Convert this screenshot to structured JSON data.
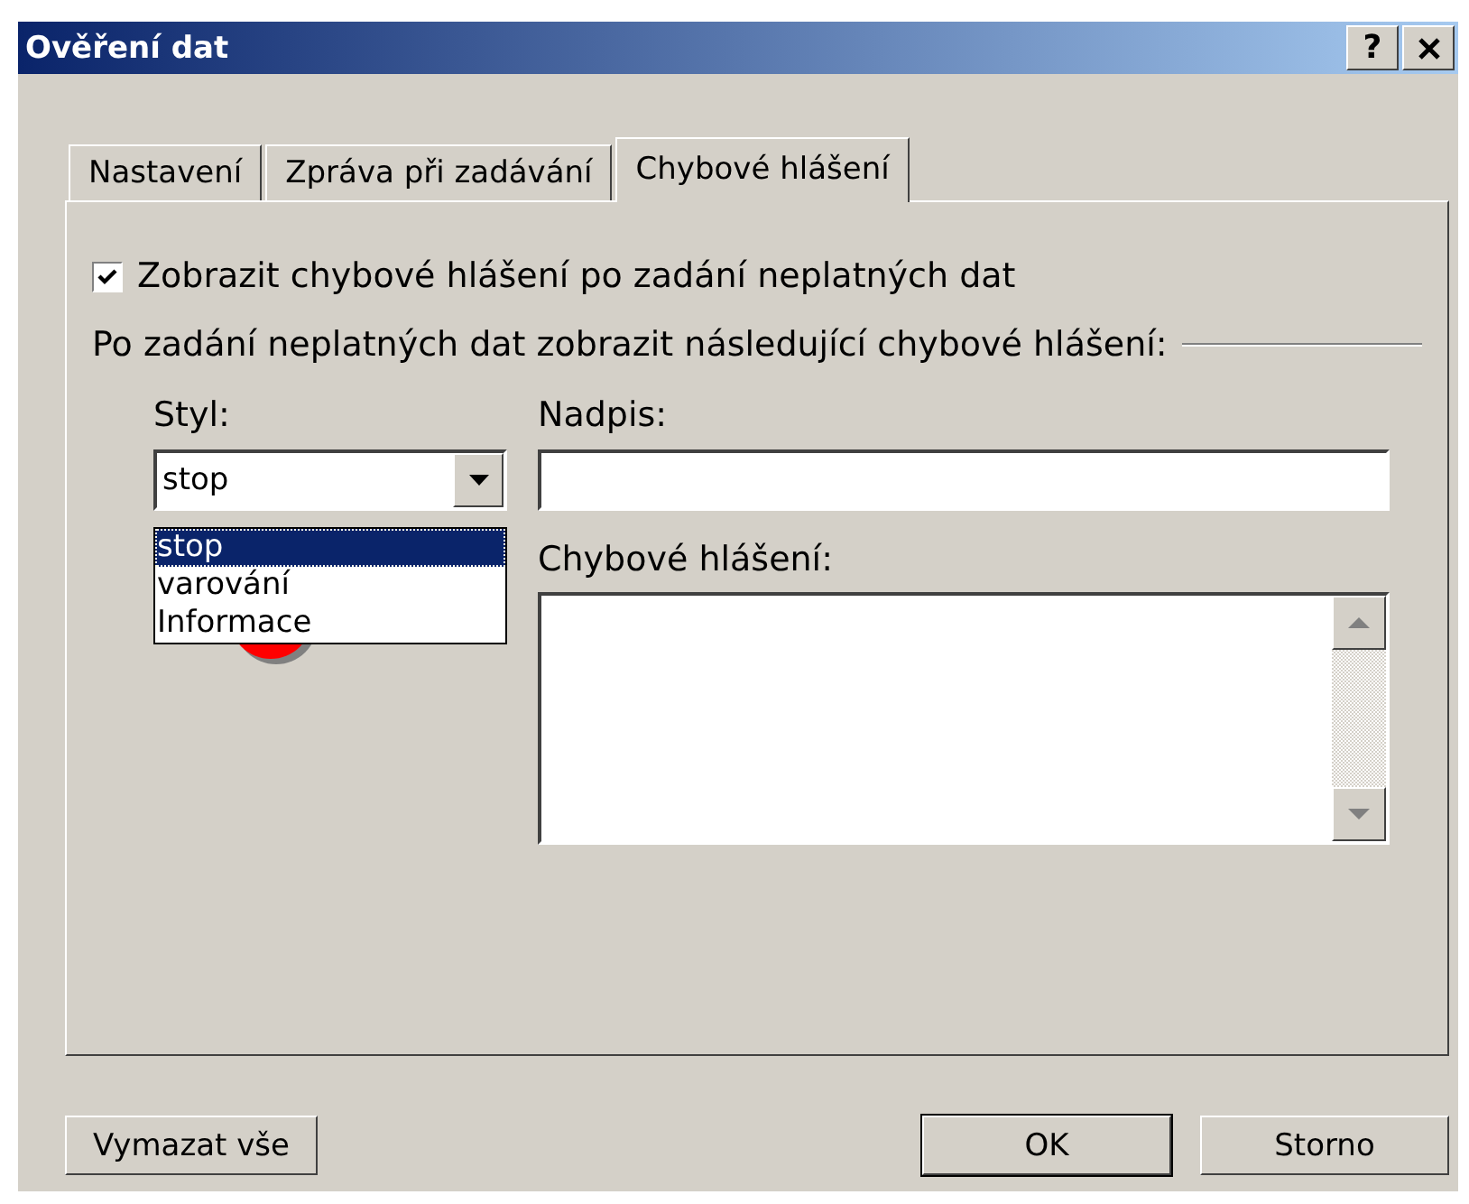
{
  "window": {
    "title": "Ověření dat",
    "help": "?"
  },
  "tabs": [
    {
      "label": "Nastavení",
      "selected": false
    },
    {
      "label": "Zpráva při zadávání",
      "selected": false
    },
    {
      "label": "Chybové hlášení",
      "selected": true
    }
  ],
  "show_alert": {
    "label": "Zobrazit chybové hlášení po zadání neplatných dat",
    "checked": true
  },
  "group_label": "Po zadání neplatných dat zobrazit následující chybové hlášení:",
  "style": {
    "label": "Styl:",
    "value": "stop",
    "expanded": true,
    "options": [
      {
        "label": "stop",
        "selected": true
      },
      {
        "label": "varování",
        "selected": false
      },
      {
        "label": "Informace",
        "selected": false
      }
    ]
  },
  "title_field": {
    "label": "Nadpis:"
  },
  "message_field": {
    "label": "Chybové hlášení:"
  },
  "buttons": [
    {
      "label": "Vymazat vše",
      "kind": "left",
      "default": false
    },
    {
      "label": "OK",
      "kind": "right",
      "default": true
    },
    {
      "label": "Storno",
      "kind": "right",
      "default": false
    }
  ]
}
